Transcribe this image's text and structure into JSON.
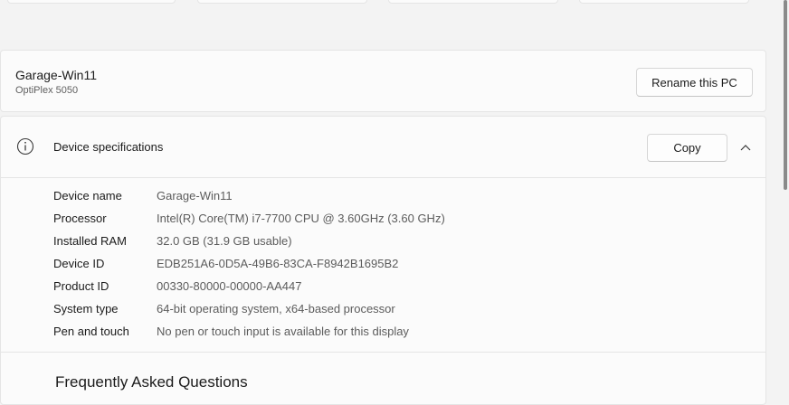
{
  "pc": {
    "name": "Garage-Win11",
    "model": "OptiPlex 5050",
    "rename_label": "Rename this PC"
  },
  "specs": {
    "title": "Device specifications",
    "copy_label": "Copy",
    "rows": [
      {
        "label": "Device name",
        "value": "Garage-Win11"
      },
      {
        "label": "Processor",
        "value": "Intel(R) Core(TM) i7-7700 CPU @ 3.60GHz (3.60 GHz)"
      },
      {
        "label": "Installed RAM",
        "value": "32.0 GB (31.9 GB usable)"
      },
      {
        "label": "Device ID",
        "value": "EDB251A6-0D5A-49B6-83CA-F8942B1695B2"
      },
      {
        "label": "Product ID",
        "value": "00330-80000-00000-AA447"
      },
      {
        "label": "System type",
        "value": "64-bit operating system, x64-based processor"
      },
      {
        "label": "Pen and touch",
        "value": "No pen or touch input is available for this display"
      }
    ]
  },
  "faq": {
    "title": "Frequently Asked Questions"
  },
  "icons": {
    "info": "info-icon",
    "chevron": "chevron-up-icon"
  }
}
